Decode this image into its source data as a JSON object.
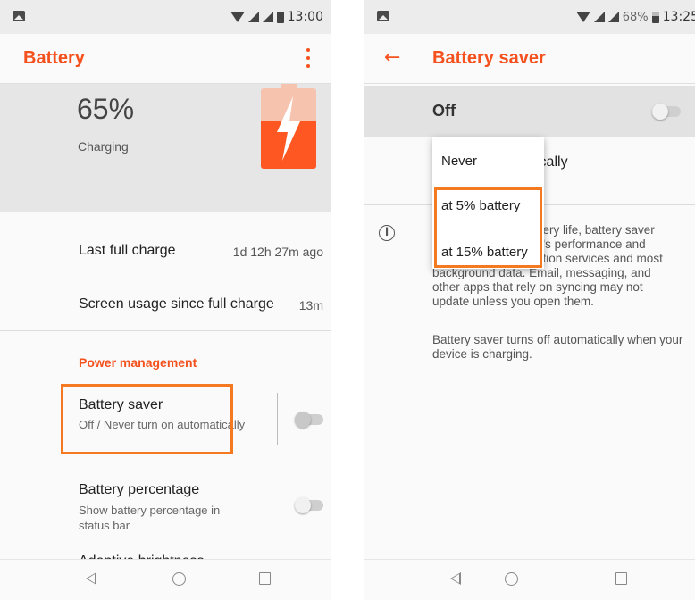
{
  "left": {
    "status": {
      "time": "13:00"
    },
    "appbar": {
      "title": "Battery"
    },
    "hero": {
      "percent": "65%",
      "status": "Charging"
    },
    "usage": {
      "last_full_charge_label": "Last full charge",
      "last_full_charge_value": "1d 12h 27m ago",
      "screen_usage_label": "Screen usage since full charge",
      "screen_usage_value": "13m"
    },
    "power_management": {
      "header": "Power management",
      "battery_saver_title": "Battery saver",
      "battery_saver_sub": "Off / Never turn on automatically",
      "battery_percentage_title": "Battery percentage",
      "battery_percentage_sub": "Show battery percentage in status bar",
      "next_item_partial": "Adaptive brightness"
    }
  },
  "right": {
    "status": {
      "battery_percent": "68%",
      "time": "13:25"
    },
    "appbar": {
      "title": "Battery saver"
    },
    "master_switch": {
      "label": "Off"
    },
    "turn_on_auto_partial": "ically",
    "dropdown": {
      "options": [
        "Never",
        "at 5% battery",
        "at 15% battery"
      ]
    },
    "info_paragraph_1": {
      "line1": "ttery life, battery saver",
      "line2": "e's performance and",
      "line3": "ation services and most",
      "line4": "background data. Email, messaging, and",
      "line5": "other apps that rely on syncing may not",
      "line6": "update unless you open them."
    },
    "info_paragraph_2": "Battery saver turns off automatically when your device is charging."
  },
  "colors": {
    "accent": "#f4511e",
    "highlight_border": "#f47920",
    "battery_fill": "#ff5722",
    "battery_empty": "#f6c4ae"
  },
  "icons": [
    "notification-icon",
    "wifi-icon",
    "signal-icon",
    "battery-icon",
    "overflow-menu-icon",
    "back-arrow-icon",
    "info-icon",
    "lightning-icon",
    "nav-back-icon",
    "nav-home-icon",
    "nav-recents-icon"
  ]
}
